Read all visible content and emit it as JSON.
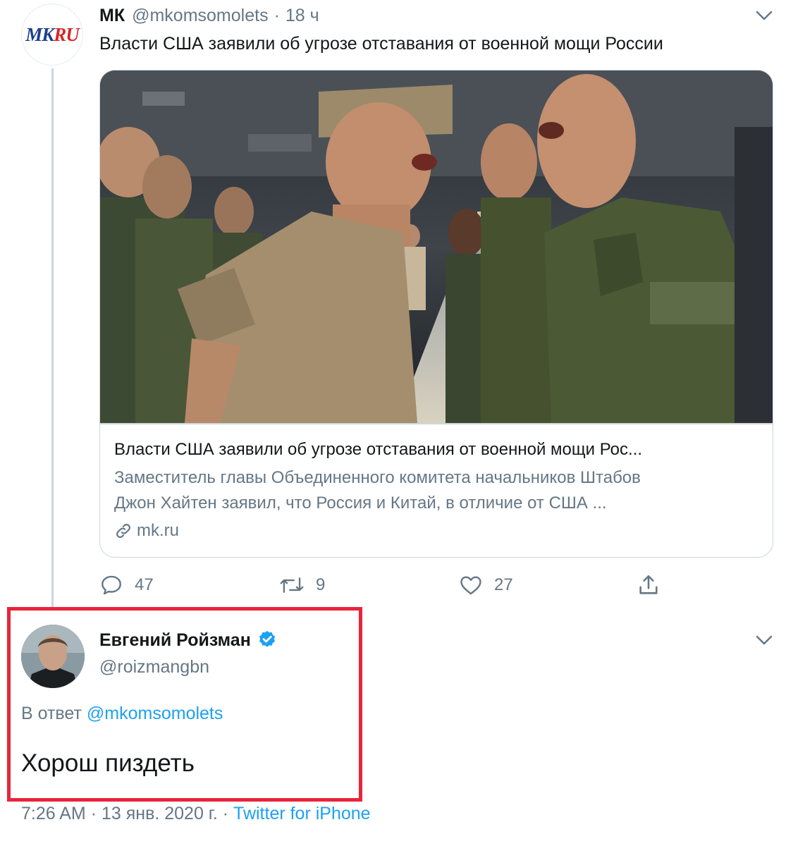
{
  "tweet1": {
    "avatar_logo_mk": "MK",
    "avatar_logo_ru": "RU",
    "name": "МК",
    "handle": "@mkomsomolets",
    "separator": "·",
    "time": "18 ч",
    "text": "Власти США заявили об угрозе отставания от военной мощи России",
    "card": {
      "image_icon": "soldiers-photo",
      "title": "Власти США заявили об угрозе отставания от военной мощи Рос...",
      "description_line1": "Заместитель главы Объединенного комитета начальников Штабов",
      "description_line2": "Джон Хайтен заявил, что Россия и Китай, в отличие от США ...",
      "domain": "mk.ru"
    },
    "actions": {
      "replies": "47",
      "retweets": "9",
      "likes": "27"
    }
  },
  "tweet2": {
    "name": "Евгений Ройзман",
    "handle": "@roizmangbn",
    "reply_prefix": "В ответ",
    "reply_mention": "@mkomsomolets",
    "text": "Хорош пиздеть",
    "time": "7:26 AM",
    "separator": "·",
    "date": "13 янв. 2020 г.",
    "source": "Twitter for iPhone"
  },
  "colors": {
    "text": "#14171a",
    "secondary": "#657786",
    "link": "#1da1f2",
    "border": "#ccd6dd",
    "highlight": "#e8243c"
  }
}
